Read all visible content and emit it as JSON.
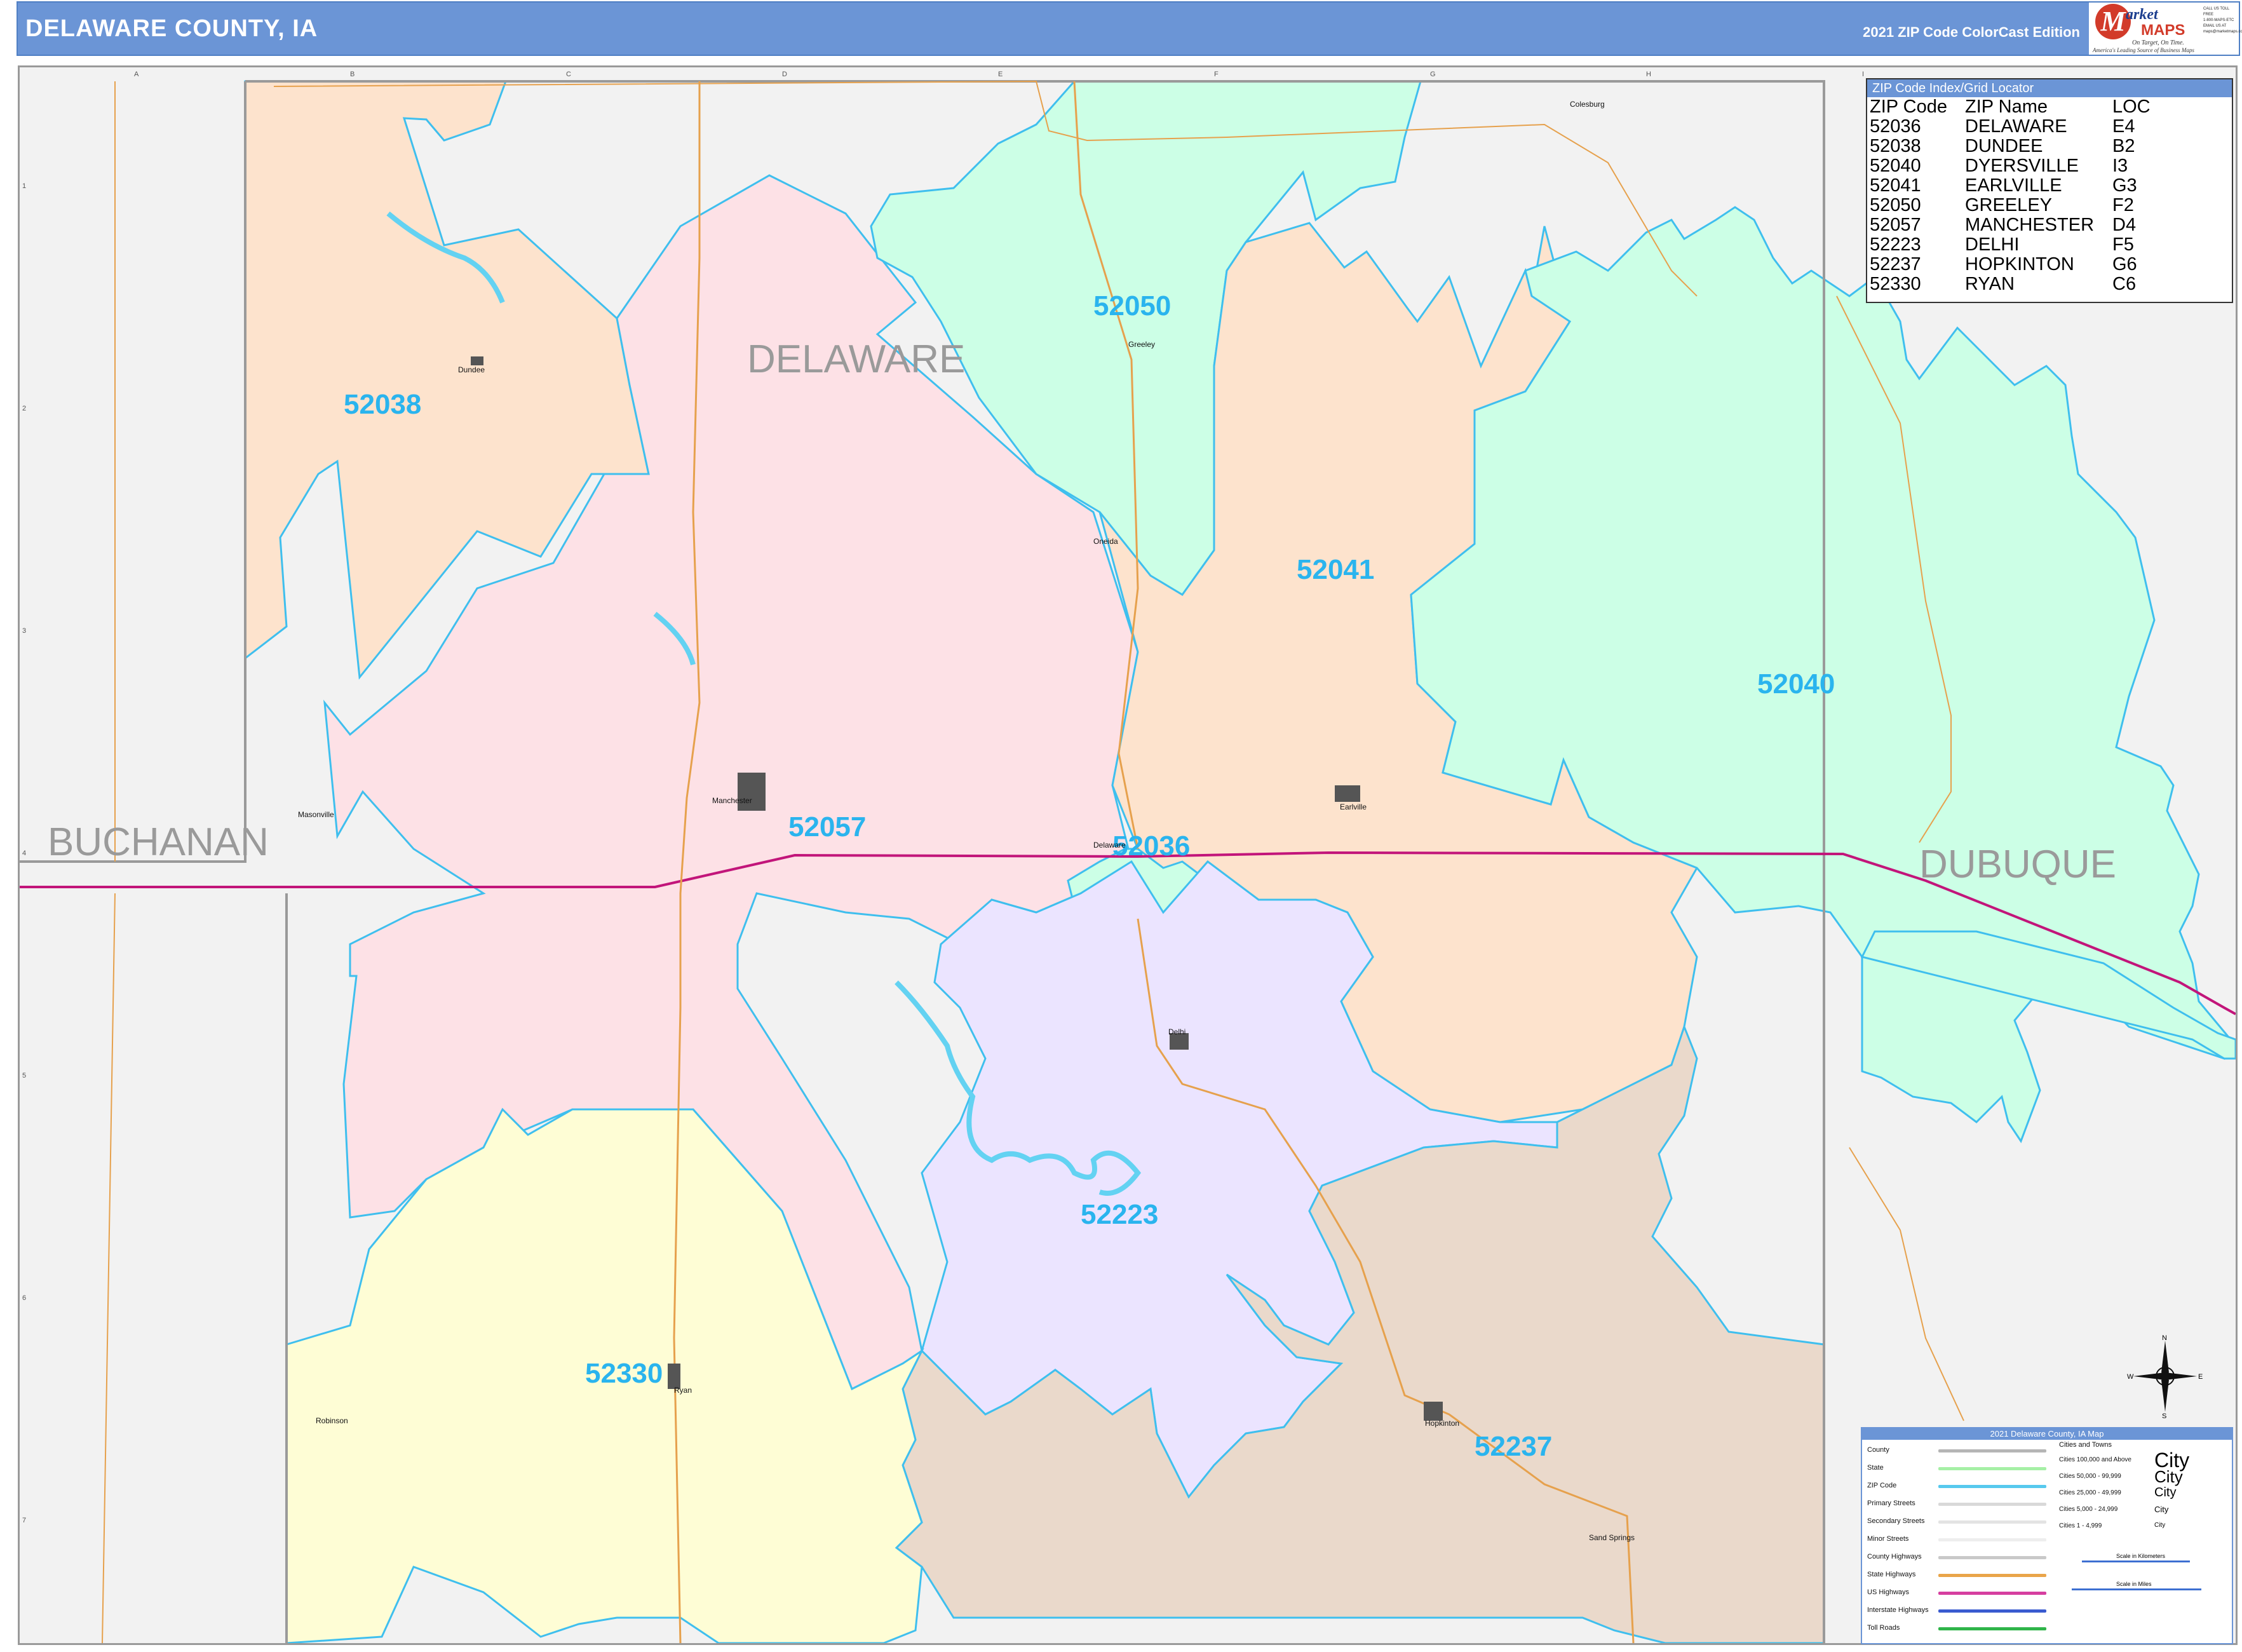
{
  "header": {
    "title": "DELAWARE COUNTY, IA",
    "edition": "2021 ZIP Code ColorCast Edition",
    "logo": {
      "m": "M",
      "market": "arket",
      "maps": "MAPS",
      "tagline1": "On Target, On Time.",
      "tagline2": "America's Leading Source of Business Maps",
      "contact": [
        "CALL US TOLL FREE",
        "1-800-MAPS-ETC",
        "EMAIL US AT",
        "maps@marketmaps.com"
      ]
    }
  },
  "county_labels": {
    "delaware": "DELAWARE",
    "buchanan": "BUCHANAN",
    "dubuque": "DUBUQUE"
  },
  "zip_areas": [
    {
      "zip": "52038",
      "color": "#fde3cd"
    },
    {
      "zip": "52057",
      "color": "#fde1e6"
    },
    {
      "zip": "52050",
      "color": "#ccffe6"
    },
    {
      "zip": "52041",
      "color": "#fde3cd"
    },
    {
      "zip": "52040",
      "color": "#ccffe6"
    },
    {
      "zip": "52036",
      "color": "#ccffe6"
    },
    {
      "zip": "52223",
      "color": "#ebe4ff"
    },
    {
      "zip": "52237",
      "color": "#ead9cb"
    },
    {
      "zip": "52330",
      "color": "#fefdd5"
    }
  ],
  "towns": {
    "dundee": "Dundee",
    "greeley": "Greeley",
    "oneida": "Oneida",
    "colesburg": "Colesburg",
    "masonville": "Masonville",
    "manchester": "Manchester",
    "delaware": "Delaware",
    "earlville": "Earlville",
    "delhi": "Delhi",
    "ryan": "Ryan",
    "robinson": "Robinson",
    "hopkinton": "Hopkinton",
    "sand_springs": "Sand Springs"
  },
  "grid": {
    "columns": [
      "A",
      "B",
      "C",
      "D",
      "E",
      "F",
      "G",
      "H",
      "I"
    ],
    "rows": [
      "1",
      "2",
      "3",
      "4",
      "5",
      "6",
      "7"
    ]
  },
  "zip_index": {
    "title": "ZIP Code Index/Grid Locator",
    "headers": [
      "ZIP Code",
      "ZIP Name",
      "LOC"
    ],
    "rows": [
      [
        "52036",
        "DELAWARE",
        "E4"
      ],
      [
        "52038",
        "DUNDEE",
        "B2"
      ],
      [
        "52040",
        "DYERSVILLE",
        "I3"
      ],
      [
        "52041",
        "EARLVILLE",
        "G3"
      ],
      [
        "52050",
        "GREELEY",
        "F2"
      ],
      [
        "52057",
        "MANCHESTER",
        "D4"
      ],
      [
        "52223",
        "DELHI",
        "F5"
      ],
      [
        "52237",
        "HOPKINTON",
        "G6"
      ],
      [
        "52330",
        "RYAN",
        "C6"
      ]
    ]
  },
  "legend": {
    "title": "2021 Delaware County, IA Map",
    "items": [
      {
        "label": "County",
        "color": "#b5b5b5"
      },
      {
        "label": "State",
        "color": "#a6f0a6"
      },
      {
        "label": "ZIP Code",
        "color": "#57c9ee"
      },
      {
        "label": "Primary Streets",
        "color": "#d9d9d9"
      },
      {
        "label": "Secondary Streets",
        "color": "#e3e3e3"
      },
      {
        "label": "Minor Streets",
        "color": "#eeeeee"
      },
      {
        "label": "County Highways",
        "color": "#c9c9c9"
      },
      {
        "label": "State Highways",
        "color": "#e9a54a"
      },
      {
        "label": "US Highways",
        "color": "#d63fa0"
      },
      {
        "label": "Interstate Highways",
        "color": "#3a5bd0"
      },
      {
        "label": "Toll Roads",
        "color": "#2fb54a"
      }
    ],
    "cities": {
      "header": "Cities and Towns",
      "rows": [
        {
          "label": "Cities 100,000 and Above",
          "sample": "City"
        },
        {
          "label": "Cities 50,000 - 99,999",
          "sample": "City"
        },
        {
          "label": "Cities 25,000 - 49,999",
          "sample": "City"
        },
        {
          "label": "Cities 5,000 - 24,999",
          "sample": "City"
        },
        {
          "label": "Cities 1 - 4,999",
          "sample": "City"
        }
      ]
    },
    "scale_km": "Scale in Kilometers",
    "scale_mi": "Scale in Miles"
  },
  "compass": {
    "n": "N",
    "s": "S",
    "e": "E",
    "w": "W"
  },
  "colors": {
    "header_bg": "#6b95d6",
    "zip_boundary": "#3fbfee",
    "state_highway": "#e6a14d",
    "interstate": "#c2157a"
  }
}
